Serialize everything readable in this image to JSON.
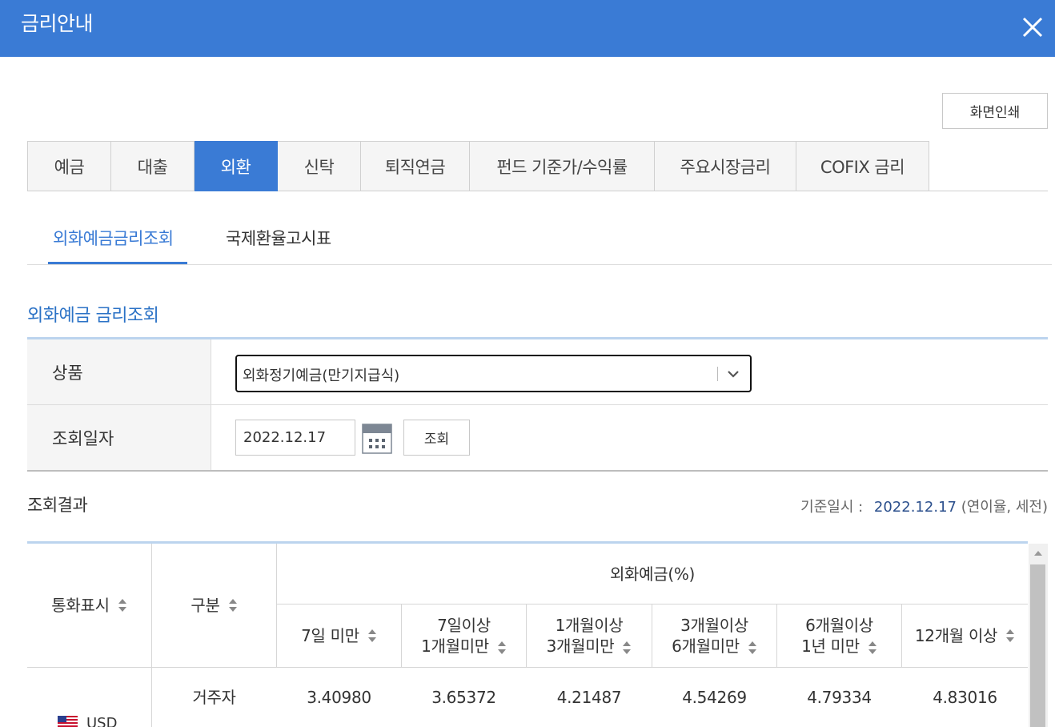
{
  "window": {
    "title": "금리안내",
    "close_icon": "close-icon"
  },
  "toolbar": {
    "print_label": "화면인쇄"
  },
  "main_tabs": [
    {
      "label": "예금",
      "active": false
    },
    {
      "label": "대출",
      "active": false
    },
    {
      "label": "외환",
      "active": true
    },
    {
      "label": "신탁",
      "active": false
    },
    {
      "label": "퇴직연금",
      "active": false
    },
    {
      "label": "펀드 기준가/수익률",
      "active": false
    },
    {
      "label": "주요시장금리",
      "active": false
    },
    {
      "label": "COFIX 금리",
      "active": false
    }
  ],
  "sub_tabs": [
    {
      "label": "외화예금금리조회",
      "active": true
    },
    {
      "label": "국제환율고시표",
      "active": false
    }
  ],
  "section": {
    "title": "외화예금 금리조회"
  },
  "form": {
    "product_label": "상품",
    "product_value": "외화정기예금(만기지급식)",
    "date_label": "조회일자",
    "date_value": "2022.12.17",
    "query_label": "조회"
  },
  "result": {
    "title": "조회결과",
    "base_label": "기준일시 :",
    "base_date": "2022.12.17",
    "base_note": "(연이율, 세전)"
  },
  "table": {
    "col_currency": "통화표시",
    "col_type": "구분",
    "group_header": "외화예금(%)",
    "period_headers": [
      [
        "7일 미만"
      ],
      [
        "7일이상",
        "1개월미만"
      ],
      [
        "1개월이상",
        "3개월미만"
      ],
      [
        "3개월이상",
        "6개월미만"
      ],
      [
        "6개월이상",
        "1년 미만"
      ],
      [
        "12개월 이상"
      ]
    ],
    "rows": [
      {
        "currency": "USD",
        "type": "거주자",
        "rates": [
          "3.40980",
          "3.65372",
          "4.21487",
          "4.54269",
          "4.79334",
          "4.83016"
        ]
      }
    ]
  },
  "colors": {
    "primary": "#3a7bd5",
    "header_border": "#bcd4ee",
    "link_text": "#2b72c6"
  }
}
